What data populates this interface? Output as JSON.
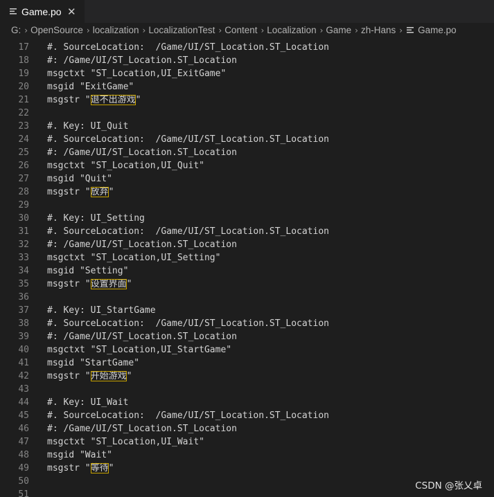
{
  "tab": {
    "label": "Game.po",
    "icon": "lines-file-icon",
    "close_glyph": "✕"
  },
  "breadcrumb": {
    "items": [
      "G:",
      "OpenSource",
      "localization",
      "LocalizationTest",
      "Content",
      "Localization",
      "Game",
      "zh-Hans"
    ],
    "file": "Game.po"
  },
  "editor": {
    "lines": [
      {
        "n": "17",
        "text": "#. SourceLocation:  /Game/UI/ST_Location.ST_Location"
      },
      {
        "n": "18",
        "text": "#: /Game/UI/ST_Location.ST_Location"
      },
      {
        "n": "19",
        "text": "msgctxt \"ST_Location,UI_ExitGame\""
      },
      {
        "n": "20",
        "text": "msgid \"ExitGame\""
      },
      {
        "n": "21",
        "pre": "msgstr \"",
        "hl": "退不出游戏",
        "post": "\""
      },
      {
        "n": "22",
        "text": ""
      },
      {
        "n": "23",
        "text": "#. Key: UI_Quit"
      },
      {
        "n": "24",
        "text": "#. SourceLocation:  /Game/UI/ST_Location.ST_Location"
      },
      {
        "n": "25",
        "text": "#: /Game/UI/ST_Location.ST_Location"
      },
      {
        "n": "26",
        "text": "msgctxt \"ST_Location,UI_Quit\""
      },
      {
        "n": "27",
        "text": "msgid \"Quit\""
      },
      {
        "n": "28",
        "pre": "msgstr \"",
        "hl": "放弃",
        "post": "\""
      },
      {
        "n": "29",
        "text": ""
      },
      {
        "n": "30",
        "text": "#. Key: UI_Setting"
      },
      {
        "n": "31",
        "text": "#. SourceLocation:  /Game/UI/ST_Location.ST_Location"
      },
      {
        "n": "32",
        "text": "#: /Game/UI/ST_Location.ST_Location"
      },
      {
        "n": "33",
        "text": "msgctxt \"ST_Location,UI_Setting\""
      },
      {
        "n": "34",
        "text": "msgid \"Setting\""
      },
      {
        "n": "35",
        "pre": "msgstr \"",
        "hl": "设置界面",
        "post": "\""
      },
      {
        "n": "36",
        "text": ""
      },
      {
        "n": "37",
        "text": "#. Key: UI_StartGame"
      },
      {
        "n": "38",
        "text": "#. SourceLocation:  /Game/UI/ST_Location.ST_Location"
      },
      {
        "n": "39",
        "text": "#: /Game/UI/ST_Location.ST_Location"
      },
      {
        "n": "40",
        "text": "msgctxt \"ST_Location,UI_StartGame\""
      },
      {
        "n": "41",
        "text": "msgid \"StartGame\""
      },
      {
        "n": "42",
        "pre": "msgstr \"",
        "hl": "开始游戏",
        "post": "\""
      },
      {
        "n": "43",
        "text": ""
      },
      {
        "n": "44",
        "text": "#. Key: UI_Wait"
      },
      {
        "n": "45",
        "text": "#. SourceLocation:  /Game/UI/ST_Location.ST_Location"
      },
      {
        "n": "46",
        "text": "#: /Game/UI/ST_Location.ST_Location"
      },
      {
        "n": "47",
        "text": "msgctxt \"ST_Location,UI_Wait\""
      },
      {
        "n": "48",
        "text": "msgid \"Wait\""
      },
      {
        "n": "49",
        "pre": "msgstr \"",
        "hl": "等待",
        "post": "\""
      },
      {
        "n": "50",
        "text": ""
      },
      {
        "n": "51",
        "text": ""
      }
    ]
  },
  "watermark": "CSDN @张乂卓",
  "colors": {
    "background": "#1e1e1e",
    "line_number": "#858585",
    "text": "#d4d4d4",
    "highlight_border": "#c8a300"
  }
}
